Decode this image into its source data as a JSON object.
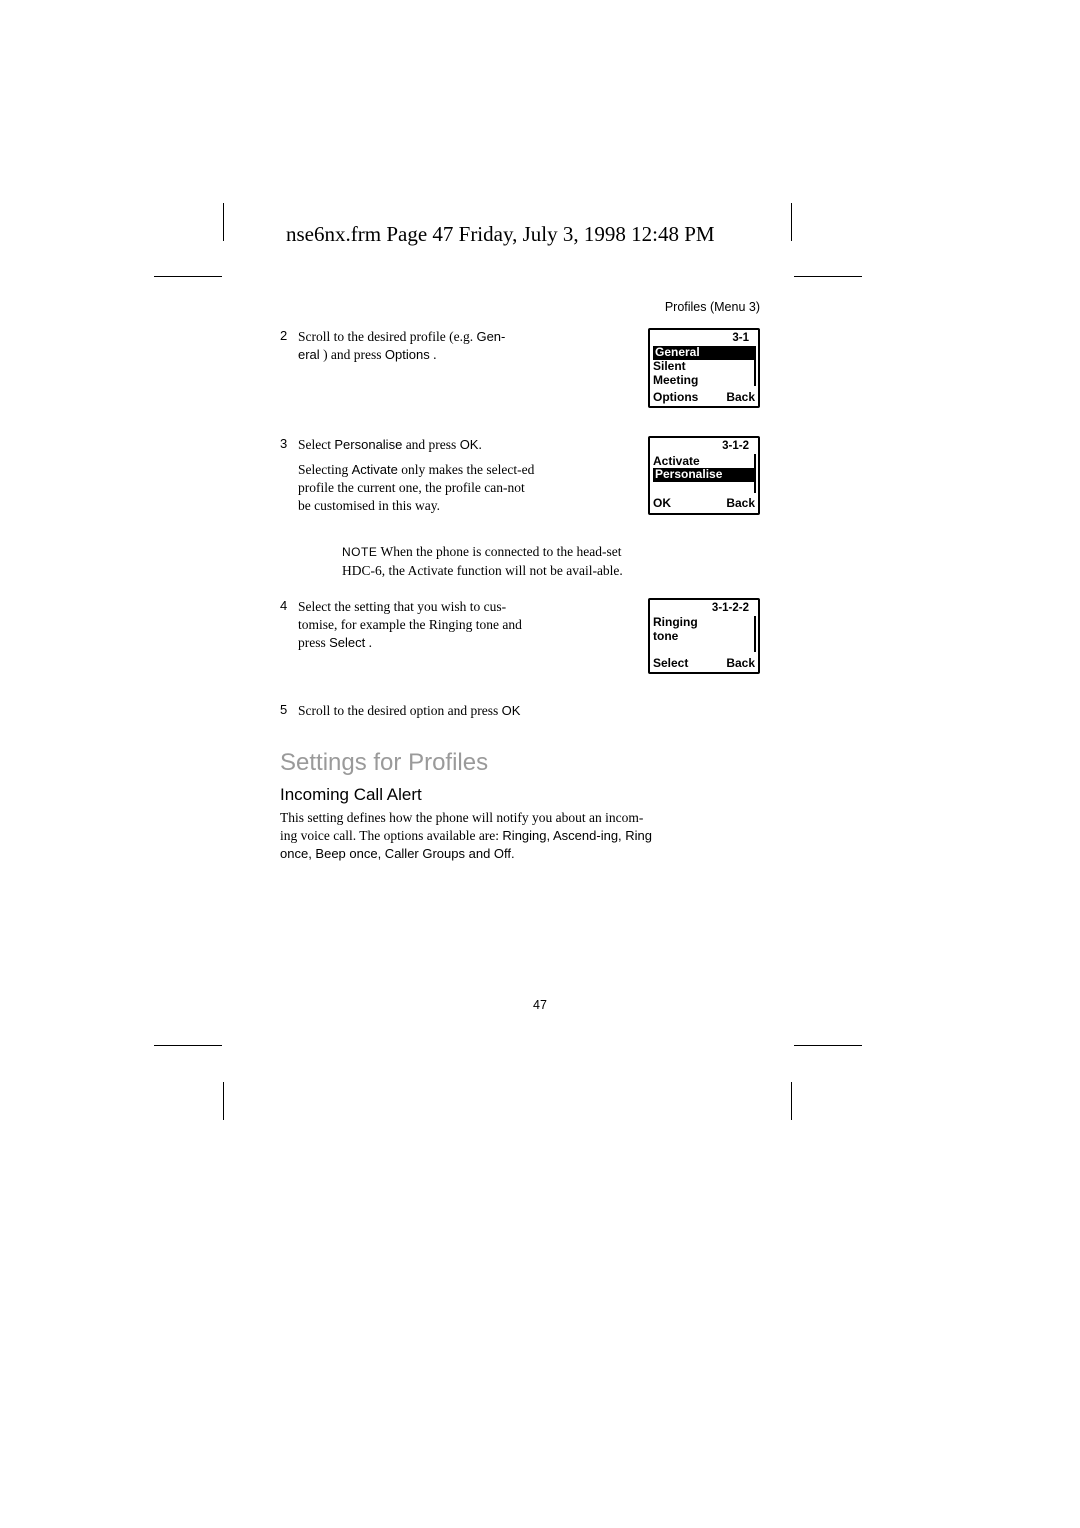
{
  "frm_header": "nse6nx.frm  Page 47  Friday, July 3, 1998  12:48 PM",
  "profiles_menu": "Profiles (Menu 3)",
  "steps": {
    "s2": {
      "num": "2",
      "t1": "Scroll to the desired profile (e.g. ",
      "b1": "Gen-",
      "t2": "eral",
      "t3": " ) and press ",
      "b2": "Options",
      "t4": " ."
    },
    "s3": {
      "num": "3",
      "t1": "Select ",
      "b1": "Personalise",
      "t2": "    and press ",
      "b2": "OK",
      "t3": "."
    },
    "s3p": {
      "t1": "Selecting ",
      "b1": "Activate",
      "t2": "    only makes the select-ed profile the current one, the profile can-not be customised in this way."
    },
    "s4": {
      "num": "4",
      "t1": "Select the setting that you wish to cus-tomise, for example the Ringing tone and press ",
      "b1": "Select",
      "t2": " ."
    },
    "s5": {
      "num": "5",
      "t1": "Scroll to the desired option and press ",
      "b1": "OK"
    }
  },
  "note": {
    "label": "NOTE",
    "text": " When the phone is connected to the head-set HDC-6, the Activate function will not be avail-able."
  },
  "screens": {
    "a": {
      "num": "3-1",
      "r1": "General",
      "r2": "Silent",
      "r3": "Meeting",
      "skL": "Options",
      "skR": "Back"
    },
    "b": {
      "num": "3-1-2",
      "r1": "Activate",
      "r2": "Personalise",
      "skL": "OK",
      "skR": "Back"
    },
    "c": {
      "num": "3-1-2-2",
      "r1": "Ringing",
      "r2": "tone",
      "skL": "Select",
      "skR": "Back"
    }
  },
  "section_heading": "Settings for Profiles",
  "sub_heading": "Incoming Call Alert",
  "body_p": {
    "t1": "This setting defines how the phone will notify you about an incom-ing voice call. The options available are: ",
    "b1": "Ringing, Ascend-ing, Ring once, Beep once, Caller Groups and Off."
  },
  "page_number": "47"
}
